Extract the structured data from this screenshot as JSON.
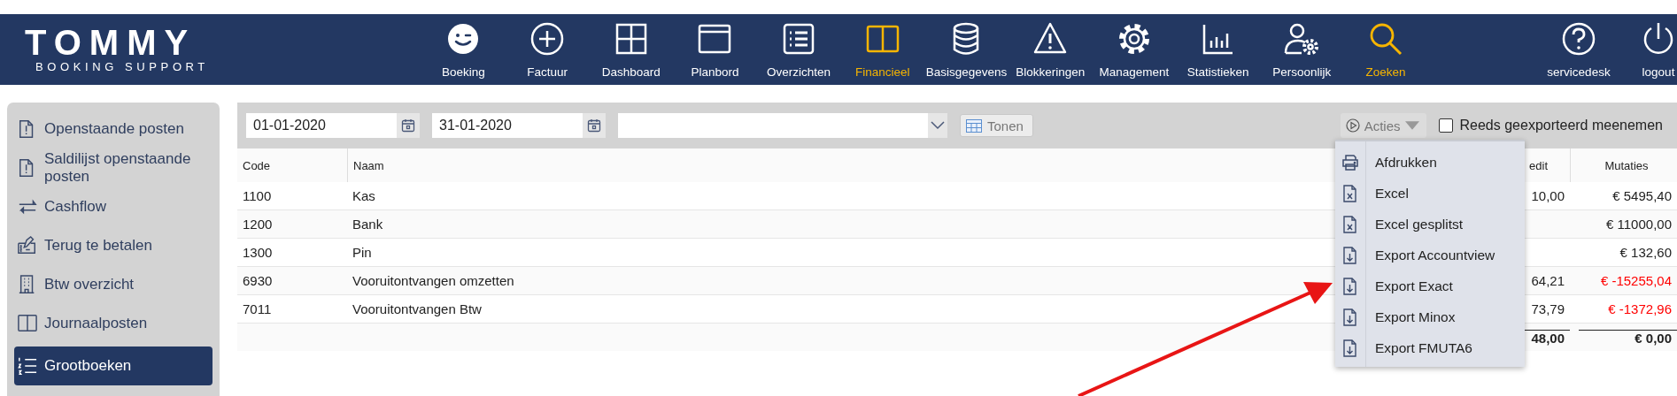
{
  "logo": {
    "title": "TOMMY",
    "subtitle": "BOOKING SUPPORT"
  },
  "nav": [
    {
      "label": "Boeking",
      "selected": false
    },
    {
      "label": "Factuur",
      "selected": false
    },
    {
      "label": "Dashboard",
      "selected": false
    },
    {
      "label": "Planbord",
      "selected": false
    },
    {
      "label": "Overzichten",
      "selected": false
    },
    {
      "label": "Financieel",
      "selected": true
    },
    {
      "label": "Basisgegevens",
      "selected": false
    },
    {
      "label": "Blokkeringen",
      "selected": false
    },
    {
      "label": "Management",
      "selected": false
    },
    {
      "label": "Statistieken",
      "selected": false
    },
    {
      "label": "Persoonlijk",
      "selected": false
    },
    {
      "label": "Zoeken",
      "selected": true
    }
  ],
  "nav_right": [
    {
      "label": "servicedesk"
    },
    {
      "label": "logout"
    }
  ],
  "sidebar": {
    "items": [
      {
        "label": "Openstaande posten",
        "selected": false
      },
      {
        "label": "Saldilijst openstaande posten",
        "selected": false
      },
      {
        "label": "Cashflow",
        "selected": false
      },
      {
        "label": "Terug te betalen",
        "selected": false
      },
      {
        "label": "Btw overzicht",
        "selected": false
      },
      {
        "label": "Journaalposten",
        "selected": false
      },
      {
        "label": "Grootboeken",
        "selected": true
      }
    ]
  },
  "filters": {
    "date_from": "01-01-2020",
    "date_to": "31-01-2020",
    "show_button": "Tonen"
  },
  "actions": {
    "button": "Acties",
    "items": [
      "Afdrukken",
      "Excel",
      "Excel gesplitst",
      "Export Accountview",
      "Export Exact",
      "Export Minox",
      "Export FMUTA6"
    ]
  },
  "include_exported": {
    "label": "Reeds geexporteerd meenemen",
    "checked": false
  },
  "table": {
    "columns": [
      "Code",
      "Naam",
      "edit",
      "Mutaties"
    ],
    "rows": [
      {
        "code": "1100",
        "name": "Kas",
        "column_3": "10,00",
        "mutations": "€ 5495,40",
        "negative": false
      },
      {
        "code": "1200",
        "name": "Bank",
        "mutations": "€ 11000,00",
        "negative": false
      },
      {
        "code": "1300",
        "name": "Pin",
        "mutations": "€ 132,60",
        "negative": false
      },
      {
        "code": "6930",
        "name": "Vooruitontvangen omzetten",
        "column_3": "64,21",
        "mutations": "€ -15255,04",
        "negative": true
      },
      {
        "code": "7011",
        "name": "Vooruitontvangen Btw",
        "column_3": "73,79",
        "mutations": "€ -1372,96",
        "negative": true
      }
    ],
    "totals": {
      "column_3": "48,00",
      "mutations": "€ 0,00"
    }
  }
}
